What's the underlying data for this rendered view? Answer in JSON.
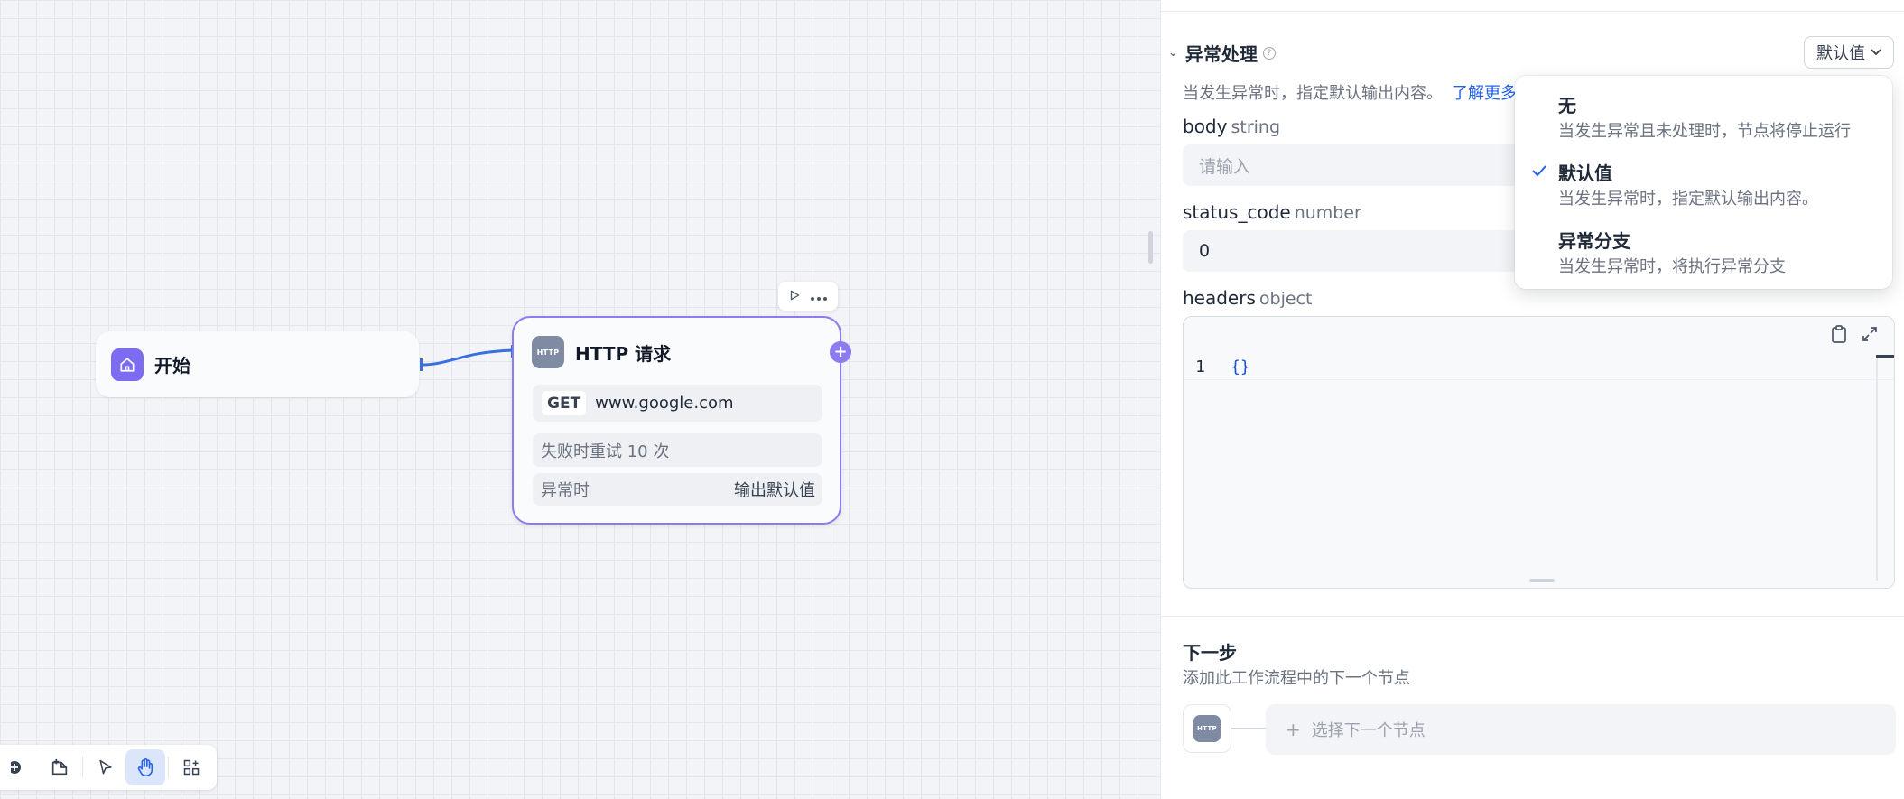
{
  "canvas": {
    "start_node": {
      "title": "开始"
    },
    "http_node": {
      "icon_text": "HTTP",
      "title": "HTTP 请求",
      "method": "GET",
      "url": "www.google.com",
      "retry": "失败时重试 10 次",
      "error_label": "异常时",
      "error_value": "输出默认值"
    },
    "colors": {
      "accent": "#8b7cf0",
      "edge": "#3b6fe0",
      "start_icon": "#7c6cf2"
    }
  },
  "panel": {
    "error_section": {
      "title": "异常处理",
      "mode": "默认值",
      "description": "当发生异常时，指定默认输出内容。",
      "learn_more": "了解更多"
    },
    "fields": [
      {
        "name": "body",
        "type": "string",
        "placeholder": "请输入",
        "value": ""
      },
      {
        "name": "status_code",
        "type": "number",
        "value": "0"
      },
      {
        "name": "headers",
        "type": "object"
      }
    ],
    "code_editor": {
      "line_number": "1",
      "code": "{}"
    },
    "next_step": {
      "title": "下一步",
      "description": "添加此工作流程中的下一个节点",
      "node_icon_text": "HTTP",
      "select_label": "选择下一个节点"
    }
  },
  "dropdown": {
    "options": [
      {
        "title": "无",
        "desc": "当发生异常且未处理时，节点将停止运行",
        "selected": false
      },
      {
        "title": "默认值",
        "desc": "当发生异常时，指定默认输出内容。",
        "selected": true
      },
      {
        "title": "异常分支",
        "desc": "当发生异常时，将执行异常分支",
        "selected": false
      }
    ]
  }
}
